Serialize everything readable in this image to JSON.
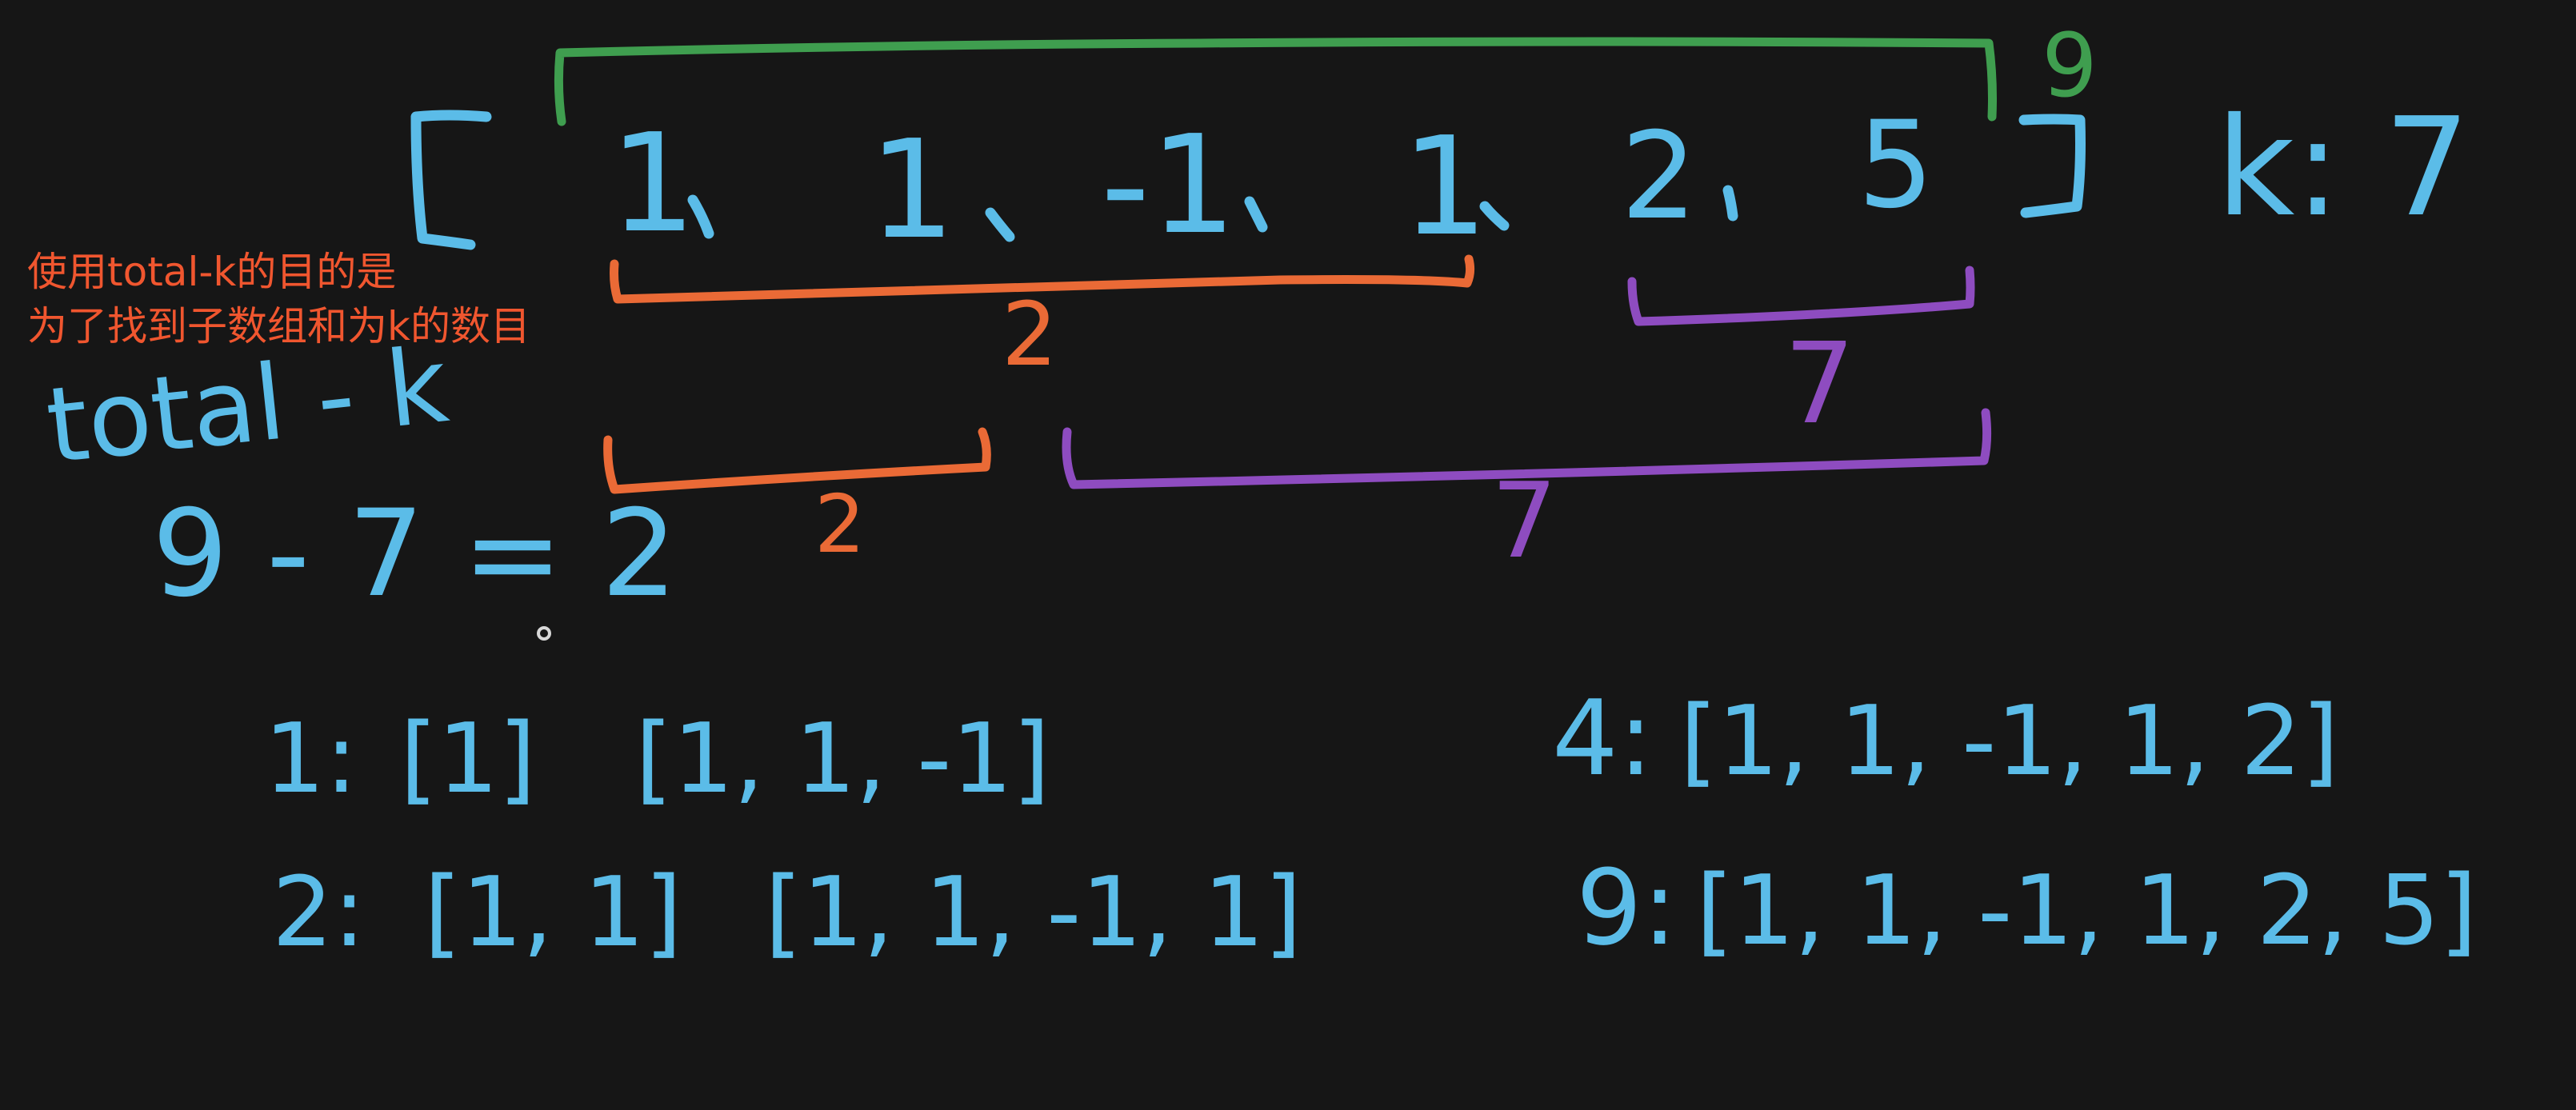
{
  "note": {
    "line1": "使用total-k的目的是",
    "line2": "为了找到子数组和为k的数目"
  },
  "array": {
    "open_bracket": "[",
    "close_bracket": "]",
    "elements": [
      "1",
      "1",
      "-1",
      "1",
      "2",
      "5"
    ],
    "separator": ",",
    "k_label": "k: 7"
  },
  "annotations": {
    "total_sum": "9",
    "top_orange_sum": "2",
    "top_purple_sum": "7",
    "bottom_orange_sum": "2",
    "bottom_purple_sum": "7"
  },
  "formula": {
    "label": "total - k",
    "equation": "9 - 7 = 2"
  },
  "prefix_map": {
    "left": [
      {
        "key": "1:",
        "arrays": [
          "[1]",
          "[1, 1, -1]"
        ]
      },
      {
        "key": "2:",
        "arrays": [
          "[1, 1]",
          "[1, 1, -1, 1]"
        ]
      }
    ],
    "right": [
      {
        "key": "4:",
        "arrays": [
          "[1, 1, -1, 1, 2]"
        ]
      },
      {
        "key": "9:",
        "arrays": [
          "[1, 1, -1, 1, 2, 5]"
        ]
      }
    ]
  },
  "colors": {
    "background": "#161616",
    "chalk_blue": "#5bbce8",
    "green": "#3f9e4f",
    "orange": "#ea6a36",
    "purple": "#8e4cc0",
    "note_red": "#f0562f"
  }
}
